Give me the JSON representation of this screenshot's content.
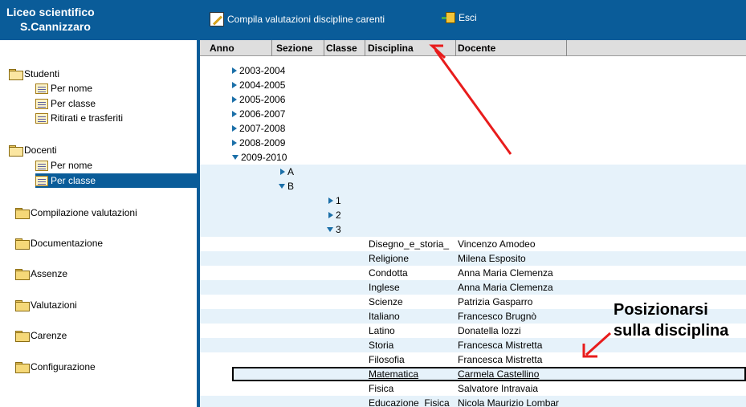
{
  "brand": {
    "line1": "Liceo scientifico",
    "line2": "S.Cannizzaro"
  },
  "toolbar": {
    "compile_label": "Compila valutazioni discipline carenti",
    "exit_label": "Esci"
  },
  "nav": {
    "studenti": "Studenti",
    "studenti_items": [
      "Per nome",
      "Per classe",
      "Ritirati e trasferiti"
    ],
    "docenti": "Docenti",
    "docenti_items": [
      "Per nome",
      "Per classe"
    ],
    "others": [
      "Compilazione valutazioni",
      "Documentazione",
      "Assenze",
      "Valutazioni",
      "Carenze",
      "Configurazione"
    ]
  },
  "grid": {
    "columns": [
      "Anno",
      "Sezione",
      "Classe",
      "Disciplina",
      "Docente"
    ],
    "years": [
      "2003-2004",
      "2004-2005",
      "2005-2006",
      "2006-2007",
      "2007-2008",
      "2008-2009",
      "2009-2010"
    ],
    "sections": [
      "A",
      "B"
    ],
    "classes": [
      "1",
      "2",
      "3"
    ],
    "subjects": [
      {
        "disciplina": "Disegno_e_storia_",
        "docente": "Vincenzo Amodeo"
      },
      {
        "disciplina": "Religione",
        "docente": "Milena Esposito"
      },
      {
        "disciplina": "Condotta",
        "docente": "Anna Maria Clemenza"
      },
      {
        "disciplina": "Inglese",
        "docente": "Anna Maria Clemenza"
      },
      {
        "disciplina": "Scienze",
        "docente": "Patrizia Gasparro"
      },
      {
        "disciplina": "Italiano",
        "docente": "Francesco Brugnò"
      },
      {
        "disciplina": "Latino",
        "docente": "Donatella Iozzi"
      },
      {
        "disciplina": "Storia",
        "docente": "Francesca Mistretta"
      },
      {
        "disciplina": "Filosofia",
        "docente": "Francesca Mistretta"
      },
      {
        "disciplina": "Matematica",
        "docente": "Carmela Castellino"
      },
      {
        "disciplina": "Fisica",
        "docente": "Salvatore Intravaia"
      },
      {
        "disciplina": "Educazione_Fisica",
        "docente": "Nicola Maurizio Lombar"
      }
    ]
  },
  "annotation": {
    "line1": "Posizionarsi",
    "line2": "sulla disciplina"
  },
  "colors": {
    "accent": "#0a5c99",
    "row_alt": "#e6f2fa",
    "arrow": "#e81c1c"
  }
}
